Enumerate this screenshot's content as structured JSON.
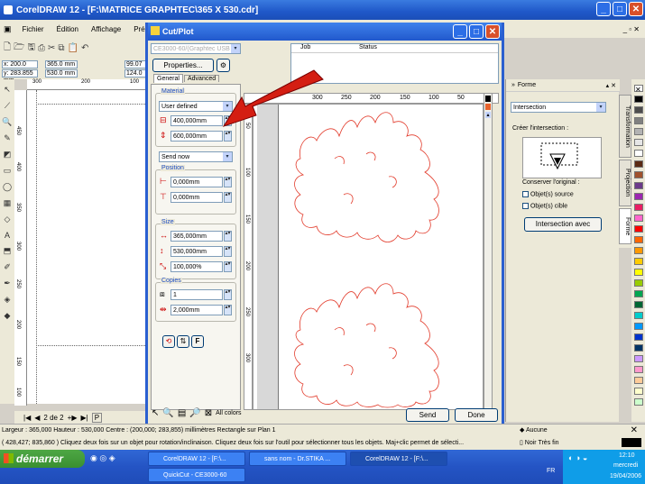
{
  "app": {
    "title": "CorelDRAW 12 - [F:\\MATRICE GRAPHTEC\\365 X 530.cdr]"
  },
  "menu": {
    "items": [
      "Fichier",
      "Édition",
      "Affichage",
      "Pré"
    ]
  },
  "propbar": {
    "x": "x: 200.0 mm",
    "y": "y: 283.855 mm",
    "w": "365.0 mm",
    "h": "530.0 mm",
    "s1": "99.07",
    "s2": "124.0"
  },
  "ruler": {
    "top": [
      "300",
      "200",
      "100"
    ],
    "left": [
      "450",
      "400",
      "350",
      "300",
      "250",
      "200",
      "150",
      "100"
    ]
  },
  "pagenav": {
    "page": "2 de 2",
    "tab": "P"
  },
  "dialog": {
    "title": "Cut/Plot",
    "plotter": "CE3000-60/(Graphtec USB )",
    "properties_button": "Properties...",
    "tabs": [
      "General",
      "Advanced"
    ],
    "job_header": "Job",
    "status_header": "Status",
    "material": {
      "label": "Material",
      "selected": "User defined",
      "width": "400,000mm",
      "height": "600,000mm"
    },
    "send_mode": "Send now",
    "position": {
      "label": "Position",
      "x": "0,000mm",
      "y": "0,000mm"
    },
    "size": {
      "label": "Size",
      "width": "365,000mm",
      "height": "530,000mm",
      "scale": "100,000%"
    },
    "copies": {
      "label": "Copies",
      "count": "1",
      "spacing": "2,000mm"
    },
    "preview_ruler_top": [
      "300",
      "250",
      "200",
      "150",
      "100",
      "50"
    ],
    "preview_ruler_left": [
      "50",
      "100",
      "150",
      "200",
      "250",
      "300"
    ],
    "colors_label": "All colors",
    "send_button": "Send",
    "done_button": "Done",
    "colors": {
      "outline": "#e23a2a",
      "arrow": "#d41e12"
    }
  },
  "docker": {
    "title": "Forme",
    "mode": "Intersection",
    "subtitle": "Créer l'intersection :",
    "keep_label": "Conserver l'original :",
    "keep_source": "Objet(s) source",
    "keep_target": "Objet(s) cible",
    "apply_button": "Intersection avec",
    "side_tabs": [
      "Transformation",
      "Projection",
      "Forme"
    ]
  },
  "status": {
    "line1": "Largeur : 365,000 Hauteur : 530,000 Centre : (200,000; 283,855) millimètres     Rectangle sur Plan 1",
    "line2": "( 428,427; 835,860 )    Cliquez deux fois sur un objet pour rotation/inclinaison. Cliquez deux fois sur l'outil pour sélectionner tous les objets. Maj+clic permet de sélecti...",
    "fill": "Aucune",
    "outline": "Noir  Très fin"
  },
  "taskbar": {
    "start": "démarrer",
    "tasks": [
      "CorelDRAW 12 - [F:\\...",
      "sans nom - Dr.STIKA ...",
      "CorelDRAW 12 - [F:\\...",
      "QuickCut - CE3000-60"
    ],
    "lang": "FR",
    "time": "12:10",
    "day": "mercredi",
    "date": "19/04/2006"
  }
}
